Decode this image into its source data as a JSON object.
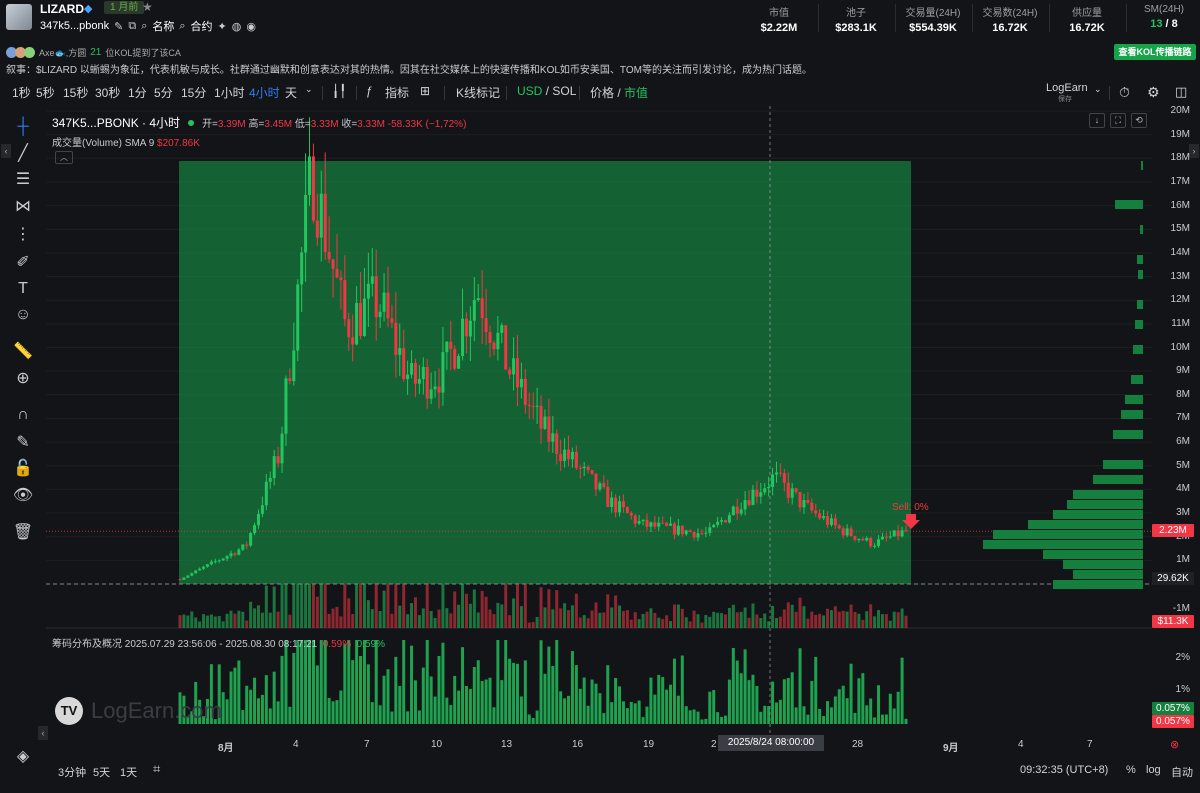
{
  "header": {
    "token_name": "LIZARD",
    "verified_icon": "diamond-icon",
    "age_badge": "1 月前",
    "address": "347k5...pbonk",
    "name_label": "名称",
    "contract_label": "合约",
    "stats": [
      {
        "label": "市值",
        "value": "$2.22M"
      },
      {
        "label": "池子",
        "value": "$283.1K"
      },
      {
        "label": "交易量(24H)",
        "value": "$554.39K"
      },
      {
        "label": "交易数(24H)",
        "value": "16.72K"
      },
      {
        "label": "供应量",
        "value": "16.72K"
      },
      {
        "label": "SM(24H)",
        "value_green": "13",
        "value_rest": " / 8"
      }
    ]
  },
  "kol": {
    "names": "Axe🐟,方圆",
    "count": "21",
    "text": "位KOL提到了该CA",
    "button": "查看KOL传播链路"
  },
  "narrative": "叙事：$LIZARD 以蜥蜴为象征，代表机敏与成长。社群通过幽默和创意表达对其的热情。因其在社交媒体上的快速传播和KOL如币安美国、TOM等的关注而引发讨论，成为热门话题。",
  "toolbar": {
    "intervals": [
      "1秒",
      "5秒",
      "15秒",
      "30秒",
      "1分",
      "5分",
      "15分",
      "1小时",
      "4小时",
      "天"
    ],
    "active_interval": "4小时",
    "indicators": "指标",
    "kline_mark": "K线标记",
    "usd": "USD",
    "sol": "SOL",
    "price": "价格",
    "mcap": "市值",
    "logearn": "LogEarn",
    "save": "保存"
  },
  "legend": {
    "symbol": "347K5...PBONK · 4小时",
    "open_label": "开=",
    "open": "3.39M",
    "high_label": "高=",
    "high": "3.45M",
    "low_label": "低=",
    "low": "3.33M",
    "close_label": "收=",
    "close": "3.33M",
    "change": "-58.33K (−1,72%)",
    "volume_label": "成交量(Volume) SMA 9",
    "volume_value": "$207.86K",
    "dist_label": "筹码分布及概况 2025.07.29 23:56:06 - 2025.08.30 08:17:21",
    "dist_red": "0.59%",
    "dist_green": "0.59%"
  },
  "sell_label": "Sell: 0%",
  "watermark": "LogEarn.com",
  "price_scale": {
    "ticks": [
      "20M",
      "19M",
      "18M",
      "17M",
      "16M",
      "15M",
      "14M",
      "13M",
      "12M",
      "11M",
      "10M",
      "9M",
      "8M",
      "7M",
      "6M",
      "5M",
      "4M",
      "3M",
      "2M",
      "1M"
    ],
    "tag_price": "2.23M",
    "tag_low": "29.62K",
    "tag_vol_tick": "-1M",
    "tag_vol": "$11.3K",
    "dist_ticks": [
      "2%",
      "1%"
    ],
    "tag_dist_green": "0.057%",
    "tag_dist_red": "0.057%"
  },
  "time_axis": {
    "ticks": [
      "8月",
      "4",
      "7",
      "10",
      "13",
      "16",
      "19",
      "2",
      "28",
      "9月",
      "4",
      "7"
    ],
    "crosshair": "2025/8/24   08:00:00"
  },
  "bottom": {
    "ranges": [
      "3分钟",
      "5天",
      "1天"
    ],
    "time": "09:32:35 (UTC+8)",
    "percent": "%",
    "log": "log",
    "auto": "自动"
  },
  "colors": {
    "up": "#22c55e",
    "down": "#f23645",
    "zone": "#16a34a",
    "accent": "#2f7cf6"
  },
  "chart_data": {
    "type": "candlestick",
    "interval": "4小时",
    "y_unit": "market cap (USD)",
    "ylim": [
      0,
      20000000
    ],
    "x_range": [
      "2025-07-30",
      "2025-08-30"
    ],
    "ohlc_last": {
      "open": 3390000,
      "high": 3450000,
      "low": 3330000,
      "close": 3330000
    },
    "current": 2230000,
    "range_low": 29620,
    "close_trend": [
      {
        "day": "07-30",
        "v": 200000
      },
      {
        "day": "08-02",
        "v": 900000
      },
      {
        "day": "08-04",
        "v": 1600000
      },
      {
        "day": "08-05",
        "v": 5500000
      },
      {
        "day": "08-05b",
        "v": 17500000
      },
      {
        "day": "08-06",
        "v": 11000000
      },
      {
        "day": "08-07",
        "v": 12000000
      },
      {
        "day": "08-08",
        "v": 8500000
      },
      {
        "day": "08-09",
        "v": 9000000
      },
      {
        "day": "08-10",
        "v": 12500000
      },
      {
        "day": "08-11",
        "v": 9000000
      },
      {
        "day": "08-12",
        "v": 6500000
      },
      {
        "day": "08-13",
        "v": 5000000
      },
      {
        "day": "08-15",
        "v": 3500000
      },
      {
        "day": "08-17",
        "v": 2500000
      },
      {
        "day": "08-19",
        "v": 2300000
      },
      {
        "day": "08-21",
        "v": 2100000
      },
      {
        "day": "08-23",
        "v": 3500000
      },
      {
        "day": "08-24",
        "v": 4500000
      },
      {
        "day": "08-25",
        "v": 3200000
      },
      {
        "day": "08-27",
        "v": 2300000
      },
      {
        "day": "08-29",
        "v": 1700000
      },
      {
        "day": "08-30",
        "v": 2230000
      }
    ]
  }
}
